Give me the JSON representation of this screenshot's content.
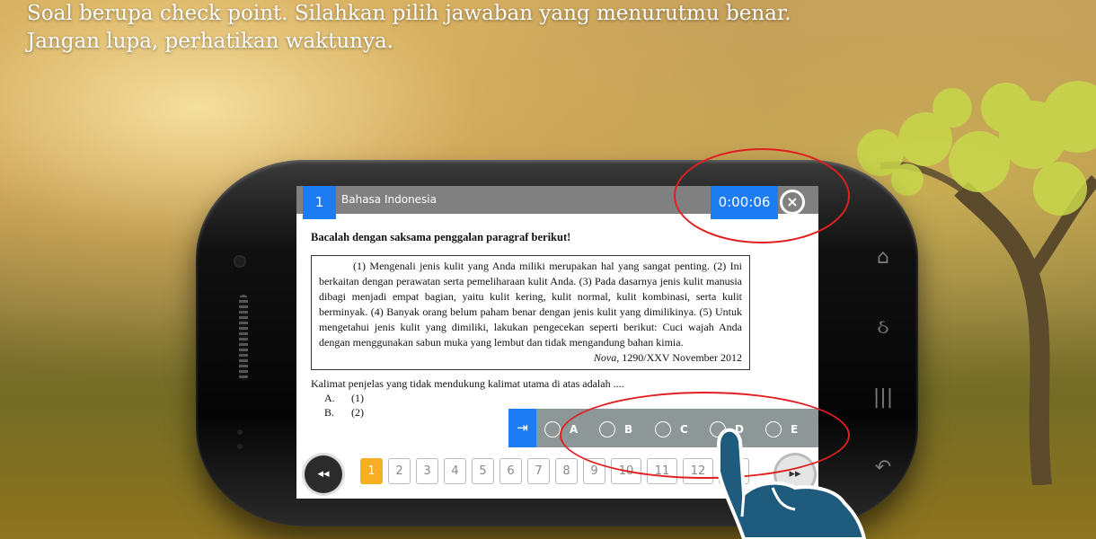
{
  "intro": {
    "line1": "Soal berupa check point. Silahkan pilih jawaban yang menurutmu benar.",
    "line2": "Jangan lupa, perhatikan waktunya."
  },
  "header": {
    "question_number": "1",
    "subject": "Bahasa Indonesia",
    "timer": "0:00:06",
    "close_symbol": "×"
  },
  "question": {
    "instruction": "Bacalah dengan saksama penggalan paragraf berikut!",
    "paragraph": "(1) Mengenali jenis kulit yang Anda miliki merupakan hal yang sangat penting. (2) Ini berkaitan dengan perawatan serta pemeliharaan kulit Anda. (3) Pada dasarnya jenis kulit manusia dibagi menjadi empat bagian, yaitu kulit kering, kulit normal, kulit kombinasi, serta kulit berminyak. (4) Banyak orang belum paham benar dengan jenis kulit yang dimilikinya. (5) Untuk mengetahui jenis kulit yang dimiliki, lakukan pengecekan seperti berikut: Cuci wajah Anda dengan menggunakan sabun muka yang lembut dan tidak mengandung bahan kimia.",
    "source_title": "Nova,",
    "source_detail": " 1290/XXV November 2012",
    "prompt": "Kalimat penjelas yang tidak mendukung kalimat utama di atas adalah ....",
    "options": [
      {
        "letter": "A.",
        "text": "(1)"
      },
      {
        "letter": "B.",
        "text": "(2)"
      }
    ]
  },
  "answer_bar": {
    "toggle_symbol": "⇥",
    "choices": [
      "A",
      "B",
      "C",
      "D",
      "E"
    ]
  },
  "navigation": {
    "prev_symbol": "◂◂",
    "next_symbol": "▸▸",
    "pages": [
      "1",
      "2",
      "3",
      "4",
      "5",
      "6",
      "7",
      "8",
      "9",
      "10",
      "11",
      "12",
      "13"
    ],
    "active_page": "1"
  },
  "colors": {
    "accent_blue": "#1e7cf2",
    "active_page": "#f6ae22",
    "highlight_ring": "#e02020",
    "answer_bar": "#8d9797"
  }
}
